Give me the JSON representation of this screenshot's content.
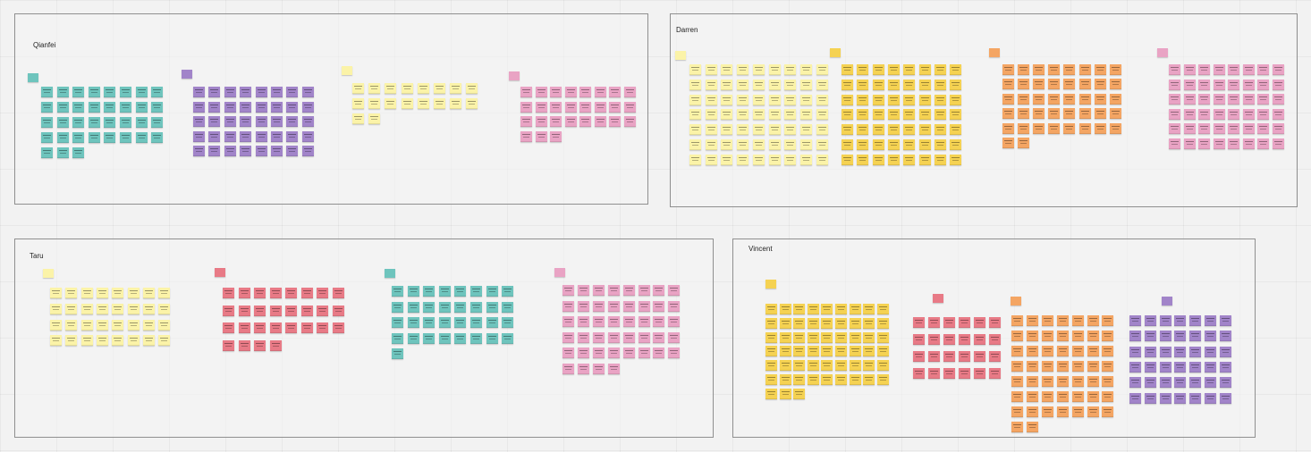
{
  "board": {
    "frames": [
      {
        "id": "qianfei",
        "title": "Qianfei",
        "groups": [
          {
            "id": "teal",
            "color": "#6ec4bd",
            "count": 35
          },
          {
            "id": "purple",
            "color": "#a184c9",
            "count": 40
          },
          {
            "id": "light-yellow",
            "color": "#fbf3a8",
            "count": 18
          },
          {
            "id": "pink",
            "color": "#e9a3c4",
            "count": 27
          }
        ]
      },
      {
        "id": "darren",
        "title": "Darren",
        "groups": [
          {
            "id": "light-yellow",
            "color": "#fbf3a8",
            "count": 63
          },
          {
            "id": "yellow",
            "color": "#f5d252",
            "count": 56
          },
          {
            "id": "orange",
            "color": "#f4a563",
            "count": 42
          },
          {
            "id": "pink",
            "color": "#e9a3c4",
            "count": 48
          }
        ]
      },
      {
        "id": "taru",
        "title": "Taru",
        "groups": [
          {
            "id": "light-yellow",
            "color": "#fbf3a8",
            "count": 32
          },
          {
            "id": "red",
            "color": "#e87a86",
            "count": 28
          },
          {
            "id": "teal",
            "color": "#6ec4bd",
            "count": 33
          },
          {
            "id": "pink",
            "color": "#e9a3c4",
            "count": 44
          }
        ]
      },
      {
        "id": "vincent",
        "title": "Vincent",
        "groups": [
          {
            "id": "yellow",
            "color": "#f5d252",
            "count": 57
          },
          {
            "id": "red",
            "color": "#e87a86",
            "count": 24
          },
          {
            "id": "orange",
            "color": "#f4a563",
            "count": 51
          },
          {
            "id": "purple",
            "color": "#a184c9",
            "count": 42
          }
        ]
      }
    ]
  }
}
